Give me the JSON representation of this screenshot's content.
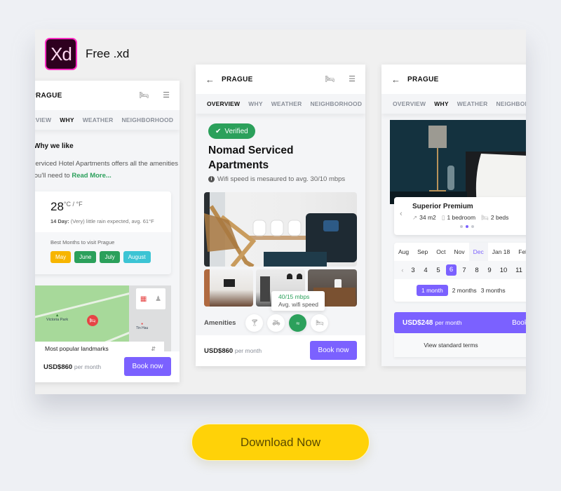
{
  "brand": {
    "badge": "Xd",
    "label": "Free .xd"
  },
  "colors": {
    "accent": "#7b61ff",
    "success": "#2ba05b",
    "cta": "#ffd208",
    "xd_bg": "#2e001f",
    "xd_border": "#ff2bc2"
  },
  "screen_why": {
    "city": "PRAGUE",
    "tabs": [
      "OVERVIEW",
      "WHY",
      "WEATHER",
      "NEIGHBORHOOD"
    ],
    "active_tab": "WHY",
    "section_title": "Why we like",
    "description": "Serviced Hotel Apartments offers all the amenities you'll need to",
    "read_more": "Read More...",
    "weather": {
      "temp": "28",
      "units": "°C / °F",
      "forecast_label": "14 Day:",
      "forecast_text": "(Very) little rain expected, avg. 61°F",
      "best_months_title": "Best Months to visit Prague",
      "months": [
        {
          "label": "May",
          "color": "#f7b500"
        },
        {
          "label": "June",
          "color": "#2ba05b"
        },
        {
          "label": "July",
          "color": "#2ba05b"
        },
        {
          "label": "August",
          "color": "#3cc4d4"
        }
      ]
    },
    "map": {
      "park_label": "Victoria Park",
      "metro_label": "Tin Hau",
      "landmarks_select": "Most popular landmarks"
    },
    "price": "USD$860",
    "per": "per month",
    "book_label": "Book now"
  },
  "screen_overview": {
    "city": "PRAGUE",
    "tabs": [
      "OVERVIEW",
      "WHY",
      "WEATHER",
      "NEIGHBORHOOD"
    ],
    "active_tab": "OVERVIEW",
    "verified_label": "Verified",
    "title": "Nomad Serviced Apartments",
    "wifi_note": "Wifi speed is mesaured to avg. 30/10 mbps",
    "tooltip_value": "40/15 mbps",
    "tooltip_label": "Avg. wifi speed",
    "amenities_label": "Amenities",
    "amenities": [
      "cocktail-icon",
      "bike-icon",
      "wifi-icon",
      "bed-icon"
    ],
    "active_amenity": "wifi-icon",
    "price": "USD$860",
    "per": "per month",
    "book_label": "Book now"
  },
  "screen_booking": {
    "city": "PRAGUE",
    "tabs": [
      "OVERVIEW",
      "WHY",
      "WEATHER",
      "NEIGHBORHOOD"
    ],
    "active_tab": "WHY",
    "room_name": "Superior Premium",
    "room_size": "34 m2",
    "bedrooms": "1 bedroom",
    "beds": "2 beds",
    "carousel_index": 2,
    "carousel_total": 3,
    "months": [
      "Aug",
      "Sep",
      "Oct",
      "Nov",
      "Dec",
      "Jan 18",
      "Feb"
    ],
    "selected_month": "Dec",
    "days": [
      "3",
      "4",
      "5",
      "6",
      "7",
      "8",
      "9",
      "10",
      "11"
    ],
    "selected_day": "6",
    "durations": [
      "1 month",
      "2 months",
      "3 months"
    ],
    "selected_duration": "1 month",
    "price": "USD$248",
    "per": "per month",
    "book_label": "Book now",
    "terms_link": "View standard terms"
  },
  "cta": {
    "label": "Download Now"
  }
}
